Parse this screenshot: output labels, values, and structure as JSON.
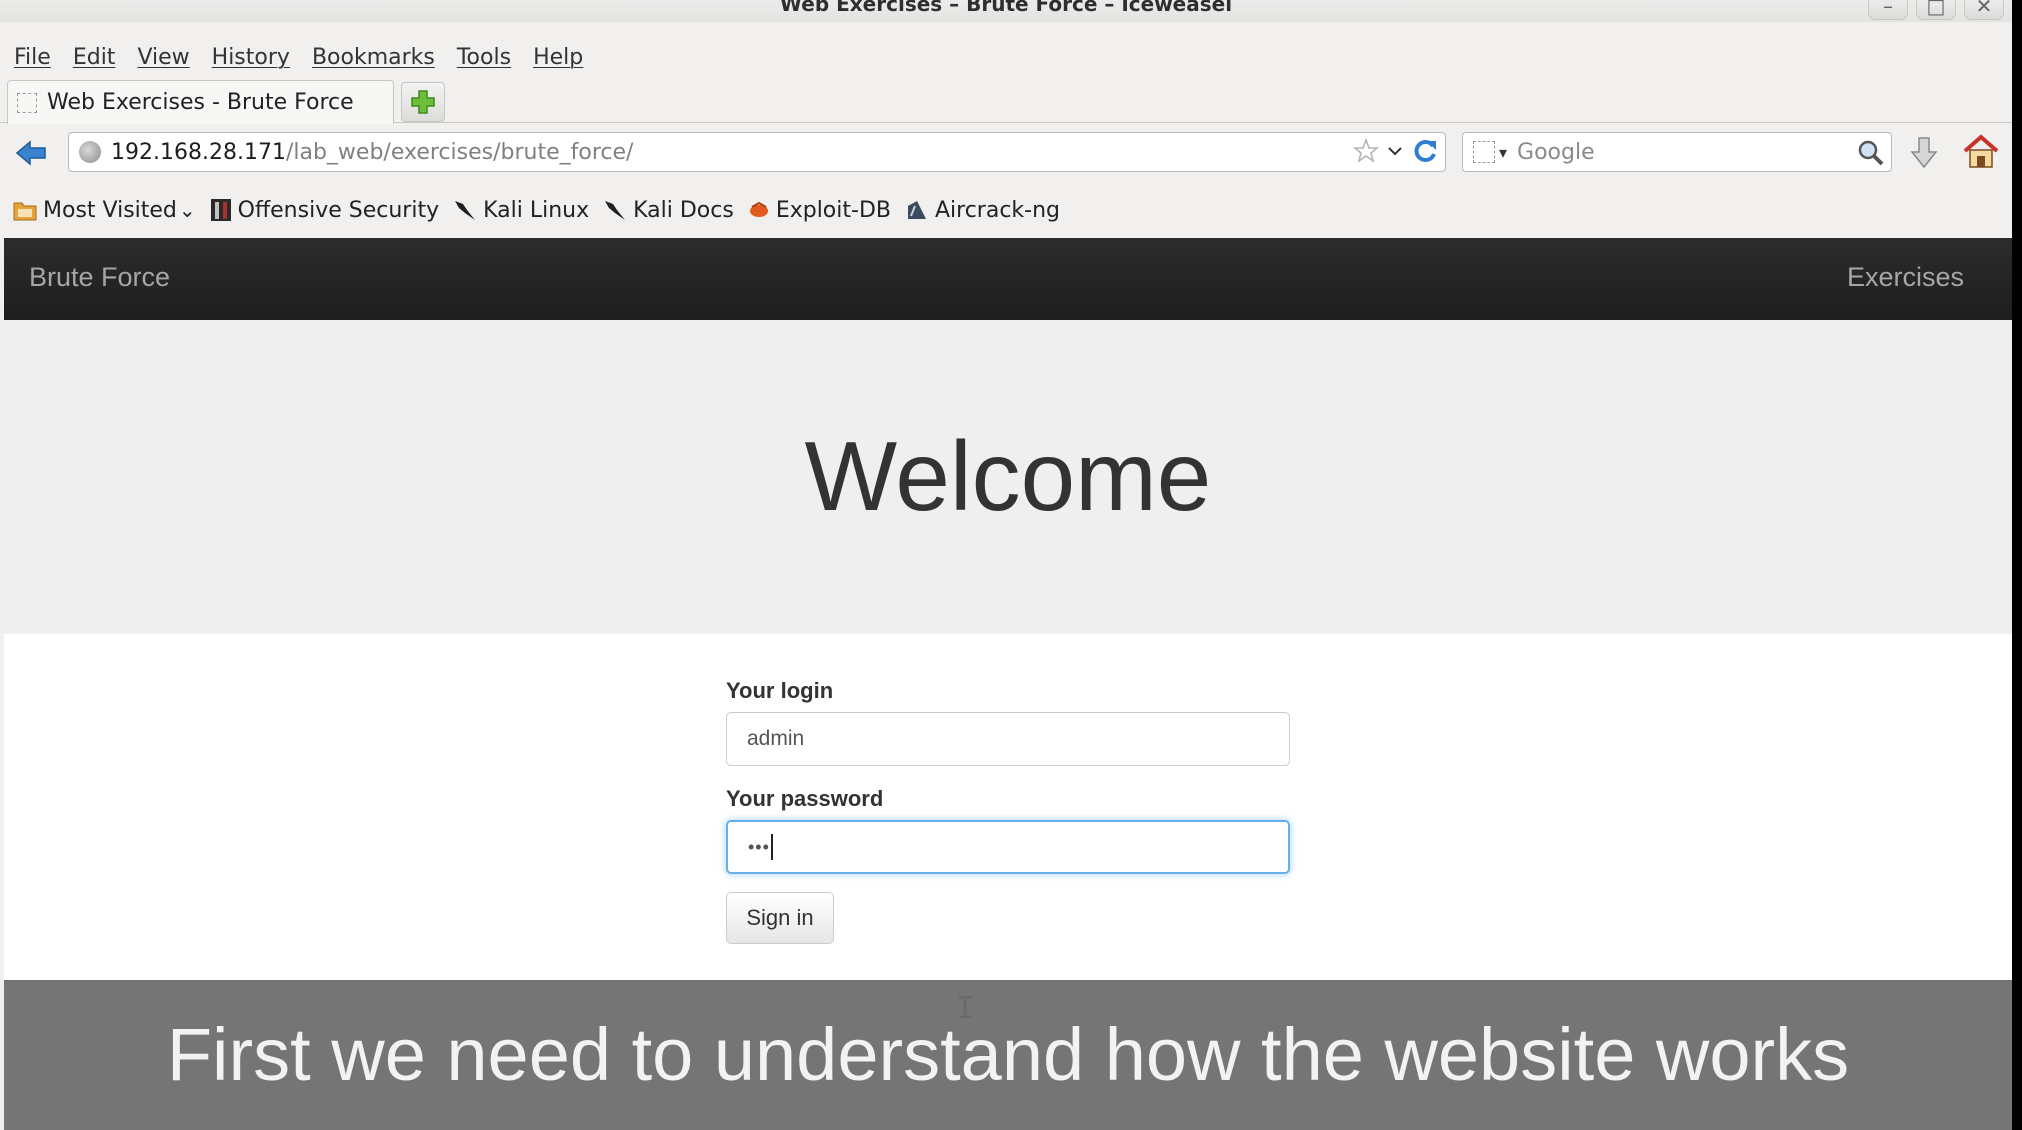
{
  "window": {
    "title": "Web Exercises – Brute Force – Iceweasel",
    "controls": [
      "–",
      "□",
      "✕"
    ]
  },
  "menubar": [
    "File",
    "Edit",
    "View",
    "History",
    "Bookmarks",
    "Tools",
    "Help"
  ],
  "tabs": [
    {
      "title": "Web Exercises - Brute Force",
      "active": true
    }
  ],
  "newtab": {
    "icon": "plus-icon"
  },
  "urlbar": {
    "host": "192.168.28.171",
    "path": "/lab_web/exercises/brute_force/"
  },
  "search": {
    "placeholder": "Google"
  },
  "bookmarks": [
    {
      "label": "Most Visited",
      "icon": "folder-icon",
      "chevron": "⌄"
    },
    {
      "label": "Offensive Security",
      "icon": "offsec-icon"
    },
    {
      "label": "Kali Linux",
      "icon": "kali-dragon-icon"
    },
    {
      "label": "Kali Docs",
      "icon": "kali-dragon-icon"
    },
    {
      "label": "Exploit-DB",
      "icon": "exploitdb-icon"
    },
    {
      "label": "Aircrack-ng",
      "icon": "aircrack-icon"
    }
  ],
  "site": {
    "brand": "Brute Force",
    "nav_link": "Exercises",
    "hero_title": "Welcome"
  },
  "form": {
    "login_label": "Your login",
    "login_value": "admin",
    "password_label": "Your password",
    "password_value": "•••",
    "submit_label": "Sign in"
  },
  "caption": "First we need to understand how the website works",
  "colors": {
    "navbar_bg": "#222222",
    "focus_border": "#66afe9",
    "hero_bg": "#f0eff0",
    "caption_bg": "#6e6e6e"
  }
}
